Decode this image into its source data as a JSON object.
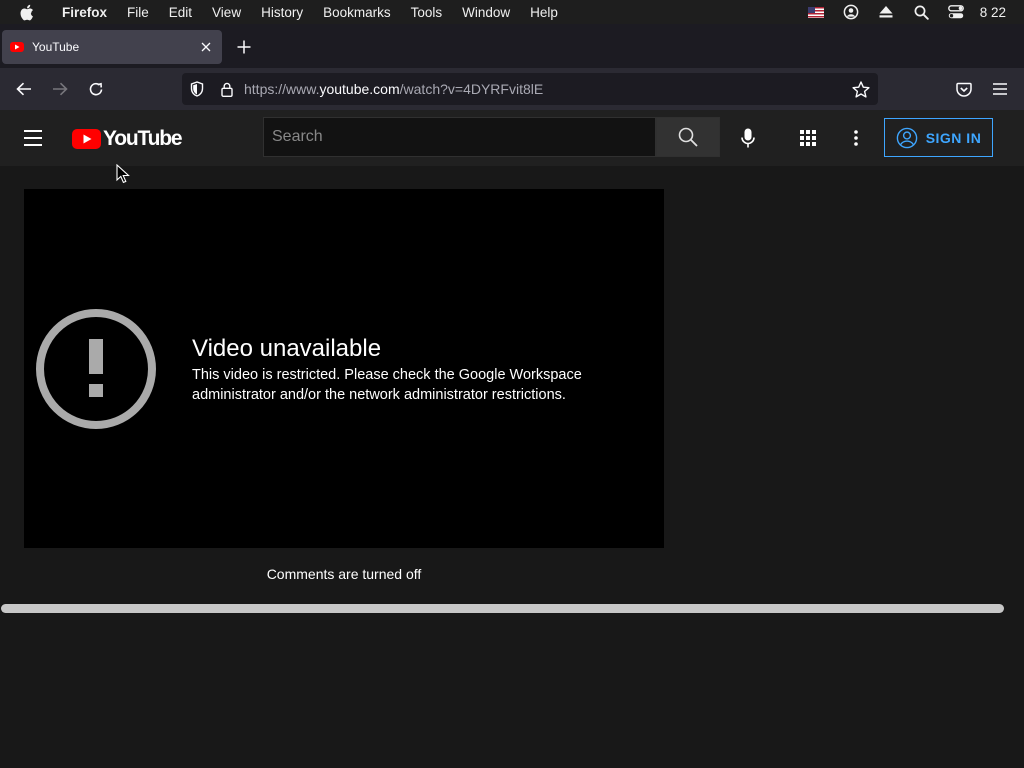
{
  "menubar": {
    "app": "Firefox",
    "items": [
      "File",
      "Edit",
      "View",
      "History",
      "Bookmarks",
      "Tools",
      "Window",
      "Help"
    ],
    "status_icons": [
      "flag-icon",
      "user-circle-icon",
      "eject-icon",
      "spotlight-search-icon",
      "control-center-icon"
    ],
    "clock": "8 22"
  },
  "browser": {
    "tab_title": "YouTube",
    "url_prefix": "https://www.",
    "url_domain": "youtube.com",
    "url_path": "/watch?v=4DYRFvit8lE"
  },
  "youtube": {
    "logo_text": "YouTube",
    "search_placeholder": "Search",
    "signin_label": "SIGN IN",
    "error_title": "Video unavailable",
    "error_message": "This video is restricted. Please check the Google Workspace administrator and/or the network administrator restrictions.",
    "comments_status": "Comments are turned off"
  },
  "colors": {
    "brand_red": "#ff0000",
    "signin_blue": "#3ea6ff"
  }
}
